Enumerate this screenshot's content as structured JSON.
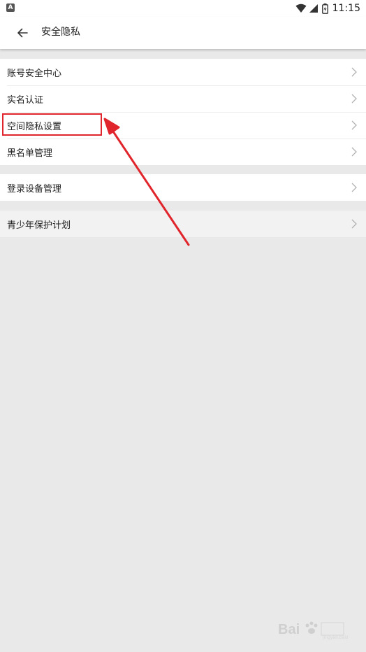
{
  "status_bar": {
    "time": "11:15",
    "icons": [
      "app-notification-icon",
      "wifi-icon",
      "cell-signal-icon",
      "battery-icon"
    ]
  },
  "app_bar": {
    "title": "安全隐私"
  },
  "groups": [
    {
      "items": [
        {
          "label": "账号安全中心"
        },
        {
          "label": "实名认证"
        },
        {
          "label": "空间隐私设置"
        },
        {
          "label": "黑名单管理"
        }
      ]
    },
    {
      "items": [
        {
          "label": "登录设备管理"
        }
      ]
    },
    {
      "items": [
        {
          "label": "青少年保护计划"
        }
      ]
    }
  ],
  "annotation": {
    "highlight_color": "#e0262c",
    "highlighted_item": "空间隐私设置"
  },
  "colors": {
    "background": "#e9e9e9",
    "surface": "#ffffff",
    "text": "#222222",
    "chevron": "#b0b0b0"
  }
}
